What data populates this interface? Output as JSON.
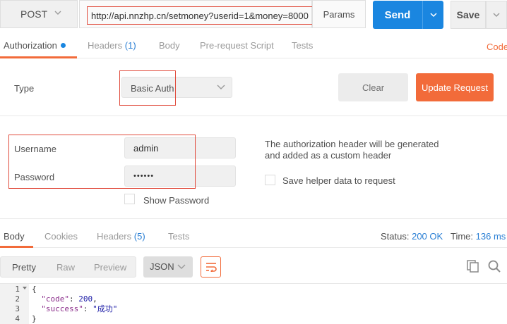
{
  "request": {
    "method": "POST",
    "url": "http://api.nnzhp.cn/setmoney?userid=1&money=8000",
    "params_label": "Params",
    "send_label": "Send",
    "save_label": "Save"
  },
  "request_tabs": {
    "authorization": "Authorization",
    "headers": "Headers",
    "headers_count": "(1)",
    "body": "Body",
    "pre_request": "Pre-request Script",
    "tests": "Tests",
    "code": "Code"
  },
  "auth": {
    "type_label": "Type",
    "type_value": "Basic Auth",
    "clear_label": "Clear",
    "update_label": "Update Request",
    "username_label": "Username",
    "username_value": "admin",
    "password_label": "Password",
    "password_value": "••••••",
    "show_password_label": "Show Password",
    "note_line1": "The authorization header will be generated",
    "note_line2": "and added as a custom header",
    "save_helper_label": "Save helper data to request"
  },
  "response_tabs": {
    "body": "Body",
    "cookies": "Cookies",
    "headers": "Headers",
    "headers_count": "(5)",
    "tests": "Tests",
    "status_label": "Status:",
    "status_value": "200 OK",
    "time_label": "Time:",
    "time_value": "136 ms"
  },
  "response_toolbar": {
    "pretty": "Pretty",
    "raw": "Raw",
    "preview": "Preview",
    "format": "JSON"
  },
  "response_body": {
    "line_numbers": [
      "1",
      "2",
      "3",
      "4"
    ],
    "open_brace": "{",
    "code_key": "\"code\"",
    "code_value": "200",
    "success_key": "\"success\"",
    "success_value": "\"成功\"",
    "close_brace": "}"
  },
  "colors": {
    "accent_orange": "#f26b3a",
    "send_blue": "#1a86e0",
    "highlight_red": "#e04a3b",
    "count_blue": "#2a7fd4"
  },
  "icons": [
    "chevron-down-icon",
    "dot-indicator-icon",
    "wrap-lines-icon",
    "copy-icon",
    "search-icon",
    "fold-arrow-icon"
  ]
}
